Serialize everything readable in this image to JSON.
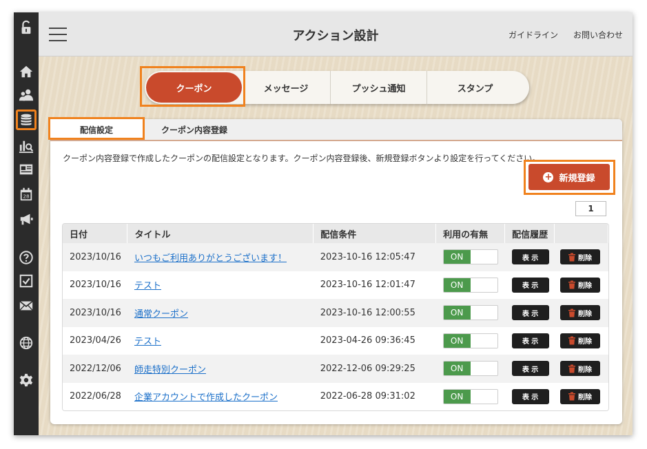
{
  "colors": {
    "accent": "#c94a2c",
    "highlight": "#f0821e",
    "sidebar": "#2b2b2b",
    "toggle_on": "#4c9a4c",
    "link": "#1a6fc9"
  },
  "sidebar": {
    "icons": [
      "unlock-icon",
      "home-icon",
      "users-icon",
      "database-icon",
      "analytics-icon",
      "news-icon",
      "calendar-icon",
      "megaphone-icon",
      "help-icon",
      "checkbox-icon",
      "mail-icon",
      "globe-icon",
      "gear-icon"
    ],
    "calendar_day": "28",
    "active": "database-icon"
  },
  "header": {
    "title": "アクション設計",
    "guide_link": "ガイドライン",
    "contact_link": "お問い合わせ"
  },
  "seg_tabs": [
    "クーポン",
    "メッセージ",
    "プッシュ通知",
    "スタンプ"
  ],
  "panel_tabs": [
    "配信設定",
    "クーポン内容登録"
  ],
  "description": "クーポン内容登録で作成したクーポンの配信設定となります。クーポン内容登録後、新規登録ボタンより設定を行ってください。",
  "new_button": "新規登録",
  "pager": {
    "current": "1"
  },
  "table": {
    "headers": [
      "日付",
      "タイトル",
      "配信条件",
      "利用の有無",
      "配信履歴",
      ""
    ],
    "toggle_label": "ON",
    "show_label": "表 示",
    "delete_label": "削除",
    "rows": [
      {
        "date": "2023/10/16",
        "title": "いつもご利用ありがとうございます！",
        "condition": "2023-10-16 12:05:47"
      },
      {
        "date": "2023/10/16",
        "title": "テスト",
        "condition": "2023-10-16 12:01:47"
      },
      {
        "date": "2023/10/16",
        "title": "通常クーポン",
        "condition": "2023-10-16 12:00:55"
      },
      {
        "date": "2023/04/26",
        "title": "テスト",
        "condition": "2023-04-26 09:36:45"
      },
      {
        "date": "2022/12/06",
        "title": "師走特別クーポン",
        "condition": "2022-12-06 09:29:25"
      },
      {
        "date": "2022/06/28",
        "title": "企業アカウントで作成したクーポン",
        "condition": "2022-06-28 09:31:02"
      }
    ]
  }
}
